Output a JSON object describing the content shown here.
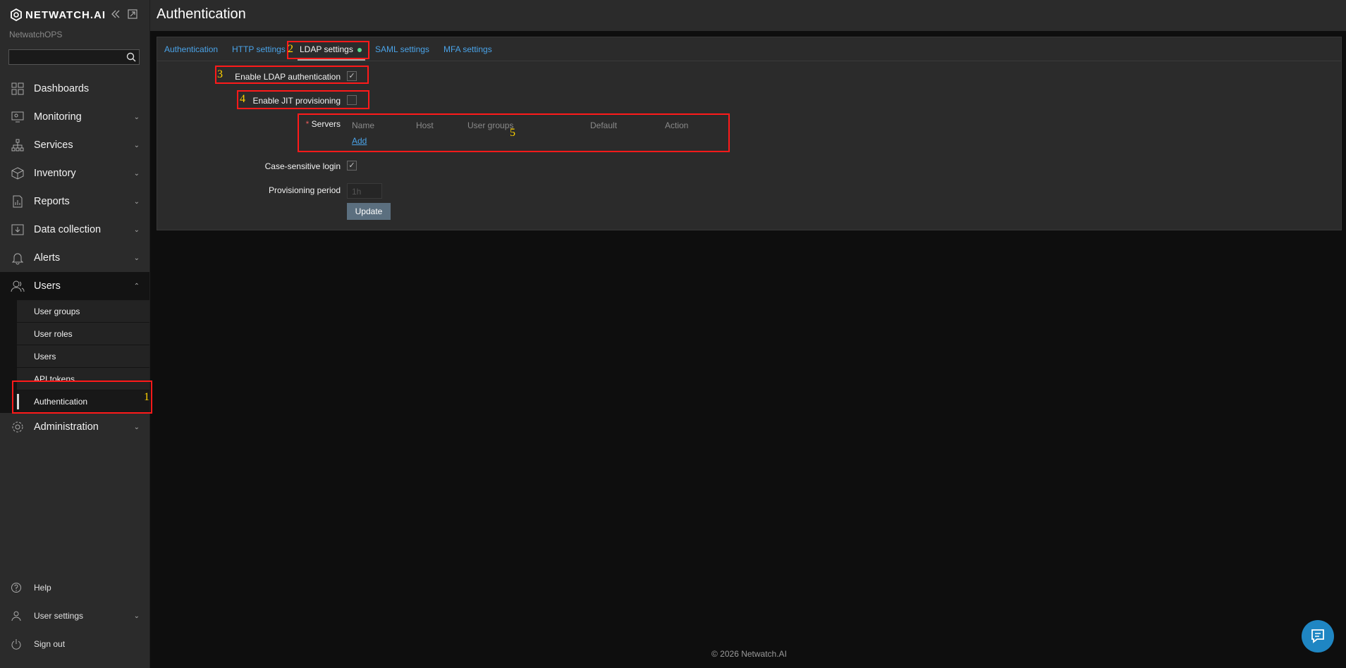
{
  "app": {
    "logo_text": "NETWATCH.AI",
    "subtitle": "NetwatchOPS",
    "search_placeholder": ""
  },
  "sidebar": {
    "items": [
      {
        "label": "Dashboards",
        "icon": "dashboard-icon",
        "chevron": ""
      },
      {
        "label": "Monitoring",
        "icon": "monitoring-icon",
        "chevron": "⌄"
      },
      {
        "label": "Services",
        "icon": "services-icon",
        "chevron": "⌄"
      },
      {
        "label": "Inventory",
        "icon": "inventory-icon",
        "chevron": "⌄"
      },
      {
        "label": "Reports",
        "icon": "reports-icon",
        "chevron": "⌄"
      },
      {
        "label": "Data collection",
        "icon": "data-collection-icon",
        "chevron": "⌄"
      },
      {
        "label": "Alerts",
        "icon": "bell-icon",
        "chevron": "⌄"
      },
      {
        "label": "Users",
        "icon": "users-icon",
        "chevron": "⌃"
      }
    ],
    "users_submenu": [
      "User groups",
      "User roles",
      "Users",
      "API tokens",
      "Authentication"
    ],
    "administration": {
      "label": "Administration",
      "chevron": "⌄"
    },
    "bottom": [
      {
        "label": "Help",
        "icon": "help-icon",
        "chevron": ""
      },
      {
        "label": "User settings",
        "icon": "user-icon",
        "chevron": "⌄"
      },
      {
        "label": "Sign out",
        "icon": "power-icon",
        "chevron": ""
      }
    ]
  },
  "header": {
    "title": "Authentication"
  },
  "tabs": [
    "Authentication",
    "HTTP settings",
    "LDAP settings",
    "SAML settings",
    "MFA settings"
  ],
  "form": {
    "enable_ldap_label": "Enable LDAP authentication",
    "enable_ldap_checked": true,
    "enable_jit_label": "Enable JIT provisioning",
    "enable_jit_checked": false,
    "servers_required_mark": "*",
    "servers_label": "Servers",
    "servers_columns": [
      "Name",
      "Host",
      "User groups",
      "Default",
      "Action"
    ],
    "add_link": "Add",
    "case_sensitive_label": "Case-sensitive login",
    "case_sensitive_checked": true,
    "provisioning_label": "Provisioning period",
    "provisioning_placeholder": "1h",
    "update_button": "Update",
    "check_mark": "✓"
  },
  "annotations": [
    "1",
    "2",
    "3",
    "4",
    "5"
  ],
  "footer": {
    "text": "© 2026 Netwatch.AI"
  },
  "colors": {
    "accent_link": "#4aa3e8",
    "annotation_box": "#ff1a1a",
    "annotation_number": "#ffd200",
    "status_dot": "#59db8f"
  }
}
